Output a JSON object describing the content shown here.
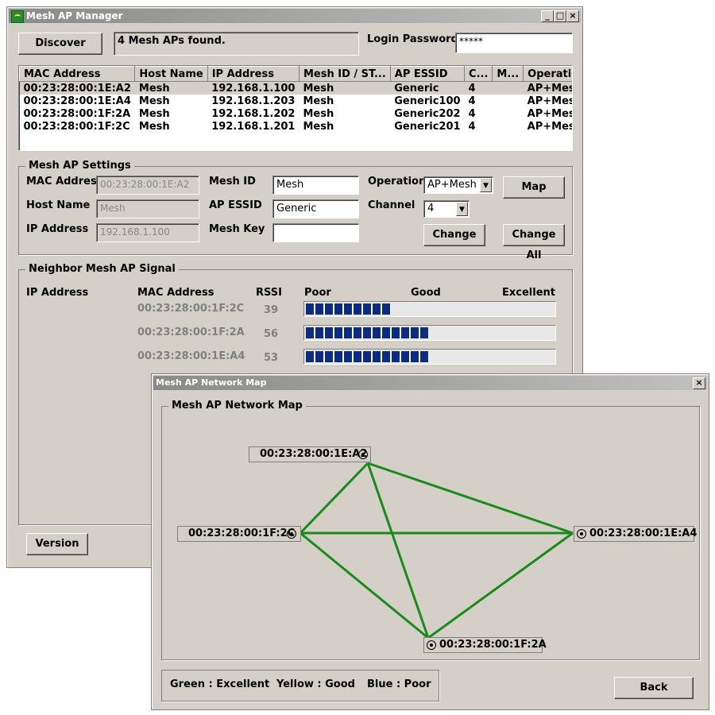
{
  "main_window": {
    "title": "Mesh AP Manager",
    "discover_label": "Discover",
    "status": "4 Mesh APs found.",
    "login_password_label": "Login Password",
    "login_password_value": "*****",
    "columns": [
      "MAC Address",
      "Host Name",
      "IP Address",
      "Mesh ID / ST...",
      "AP ESSID",
      "C...",
      "M...",
      "Operation"
    ],
    "rows": [
      [
        "00:23:28:00:1E:A2",
        "Mesh",
        "192.168.1.100",
        "Mesh",
        "Generic",
        "4",
        "",
        "AP+Mesh"
      ],
      [
        "00:23:28:00:1E:A4",
        "Mesh",
        "192.168.1.203",
        "Mesh",
        "Generic100",
        "4",
        "",
        "AP+Mesh"
      ],
      [
        "00:23:28:00:1F:2A",
        "Mesh",
        "192.168.1.202",
        "Mesh",
        "Generic202",
        "4",
        "",
        "AP+Mesh"
      ],
      [
        "00:23:28:00:1F:2C",
        "Mesh",
        "192.168.1.201",
        "Mesh",
        "Generic201",
        "4",
        "",
        "AP+Mesh"
      ]
    ],
    "settings": {
      "group_title": "Mesh AP Settings",
      "mac_label": "MAC Address",
      "mac_value": "00:23:28:00:1E:A2",
      "host_label": "Host Name",
      "host_value": "Mesh",
      "ip_label": "IP Address",
      "ip_value": "192.168.1.100",
      "mesh_id_label": "Mesh ID",
      "mesh_id_value": "Mesh",
      "essid_label": "AP ESSID",
      "essid_value": "Generic",
      "mesh_key_label": "Mesh Key",
      "mesh_key_value": "",
      "operation_label": "Operation",
      "operation_value": "AP+Mesh",
      "channel_label": "Channel",
      "channel_value": "4",
      "map_label": "Map",
      "change_label": "Change",
      "change_all_label": "Change All"
    },
    "neighbor": {
      "group_title": "Neighbor Mesh AP Signal",
      "ip_header": "IP Address",
      "mac_header": "MAC Address",
      "rssi_header": "RSSI",
      "poor": "Poor",
      "good": "Good",
      "excellent": "Excellent",
      "entries": [
        {
          "mac": "00:23:28:00:1F:2C",
          "rssi": "39",
          "level": 0.34
        },
        {
          "mac": "00:23:28:00:1F:2A",
          "rssi": "56",
          "level": 0.49
        },
        {
          "mac": "00:23:28:00:1E:A4",
          "rssi": "53",
          "level": 0.49
        }
      ]
    },
    "version_label": "Version"
  },
  "map_window": {
    "title": "Mesh AP Network Map",
    "group_title": "Mesh AP Network Map",
    "nodes": {
      "a2": "00:23:28:00:1E:A2",
      "c2c": "00:23:28:00:1F:2C",
      "a4": "00:23:28:00:1E:A4",
      "f2a": "00:23:28:00:1F:2A"
    },
    "link_color": "#1a8a1a",
    "legend": {
      "green": "Green : Excellent",
      "yellow": "Yellow : Good",
      "blue": "Blue : Poor"
    },
    "back_label": "Back"
  }
}
